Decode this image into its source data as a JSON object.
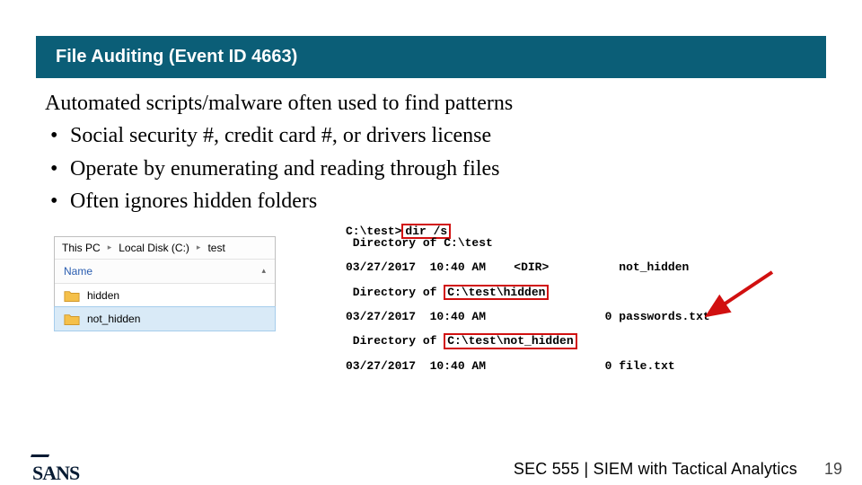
{
  "title": "File Auditing (Event ID 4663)",
  "lead": "Automated scripts/malware often used to find patterns",
  "bullets": [
    "Social security #, credit card #, or drivers license",
    "Operate by enumerating and reading through files",
    "Often ignores hidden folders"
  ],
  "explorer": {
    "crumb": {
      "root": "This PC",
      "drive": "Local Disk (C:)",
      "folder": "test"
    },
    "name_col": "Name",
    "rows": [
      {
        "name": "hidden",
        "selected": false
      },
      {
        "name": "not_hidden",
        "selected": true
      }
    ]
  },
  "terminal": {
    "prompt_path": "C:\\test>",
    "cmd": "dir /s",
    "l1": " Directory of C:\\test",
    "date": "03/27/2017",
    "time": "10:40 AM",
    "dir_mark": "<DIR>",
    "root_item": "not_hidden",
    "dir_hidden_prefix": " Directory of ",
    "dir_hidden_path": "C:\\test\\hidden",
    "hidden_size": "0",
    "hidden_file": "passwords.txt",
    "dir_nhidden_prefix": " Directory of ",
    "dir_nhidden_path": "C:\\test\\not_hidden",
    "nhidden_line": "0 file.txt"
  },
  "footer": {
    "org": "SANS",
    "course": "SEC 555 | SIEM with Tactical Analytics",
    "page": "19"
  }
}
